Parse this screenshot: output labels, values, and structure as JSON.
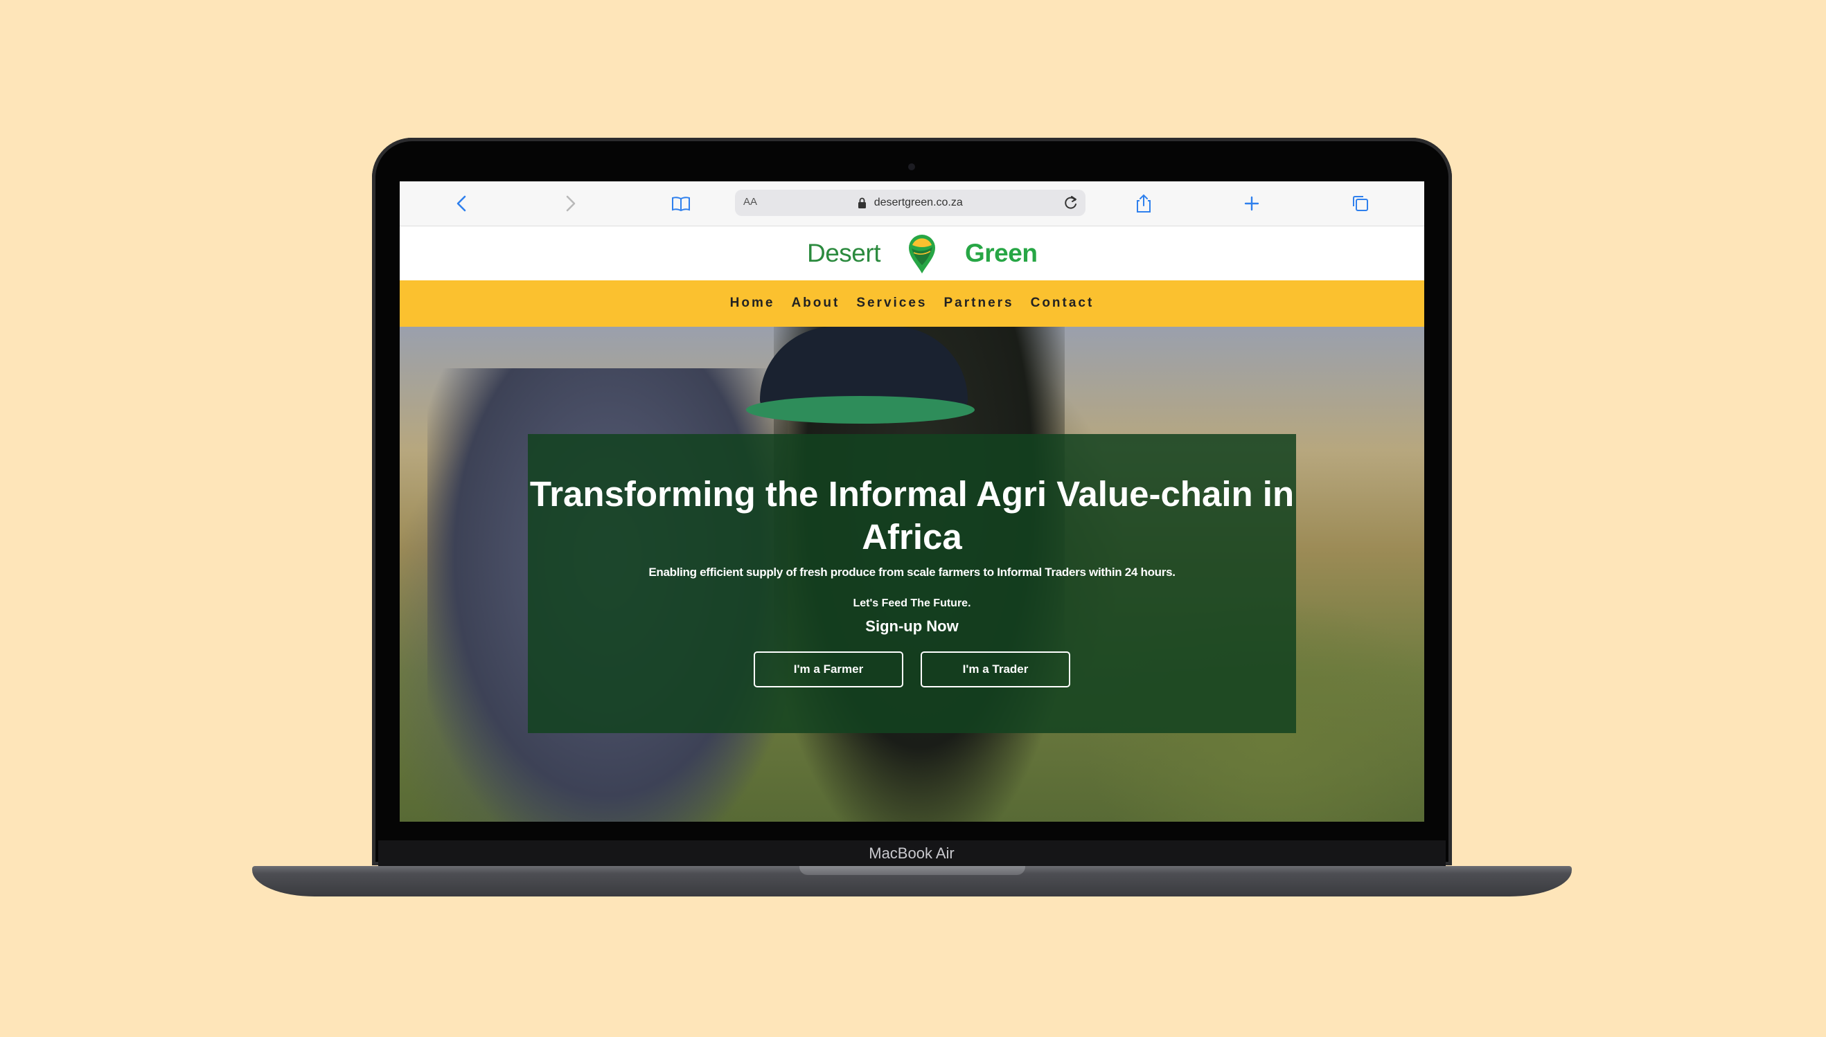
{
  "device": {
    "model_label": "MacBook Air"
  },
  "browser": {
    "text_size_label": "AA",
    "url": "desertgreen.co.za",
    "icons": [
      "back-icon",
      "forward-icon",
      "bookmarks-icon",
      "lock-icon",
      "reload-icon",
      "share-icon",
      "new-tab-icon",
      "tabs-icon"
    ]
  },
  "site": {
    "logo": {
      "word1": "Desert",
      "word2": "Green"
    },
    "nav": {
      "items": [
        "Home",
        "About",
        "Services",
        "Partners",
        "Contact"
      ]
    },
    "hero": {
      "title": "Transforming the Informal Agri Value-chain in Africa",
      "subtitle": "Enabling efficient supply of fresh produce from scale farmers to Informal Traders within 24 hours.",
      "tagline": "Let's Feed The Future.",
      "cta_heading": "Sign-up Now",
      "buttons": {
        "farmer": "I'm a Farmer",
        "trader": "I'm a Trader"
      }
    },
    "colors": {
      "brand_green": "#27a645",
      "nav_yellow": "#FBC12F",
      "overlay_green": "#13421F",
      "background": "#FEE5B9"
    }
  }
}
